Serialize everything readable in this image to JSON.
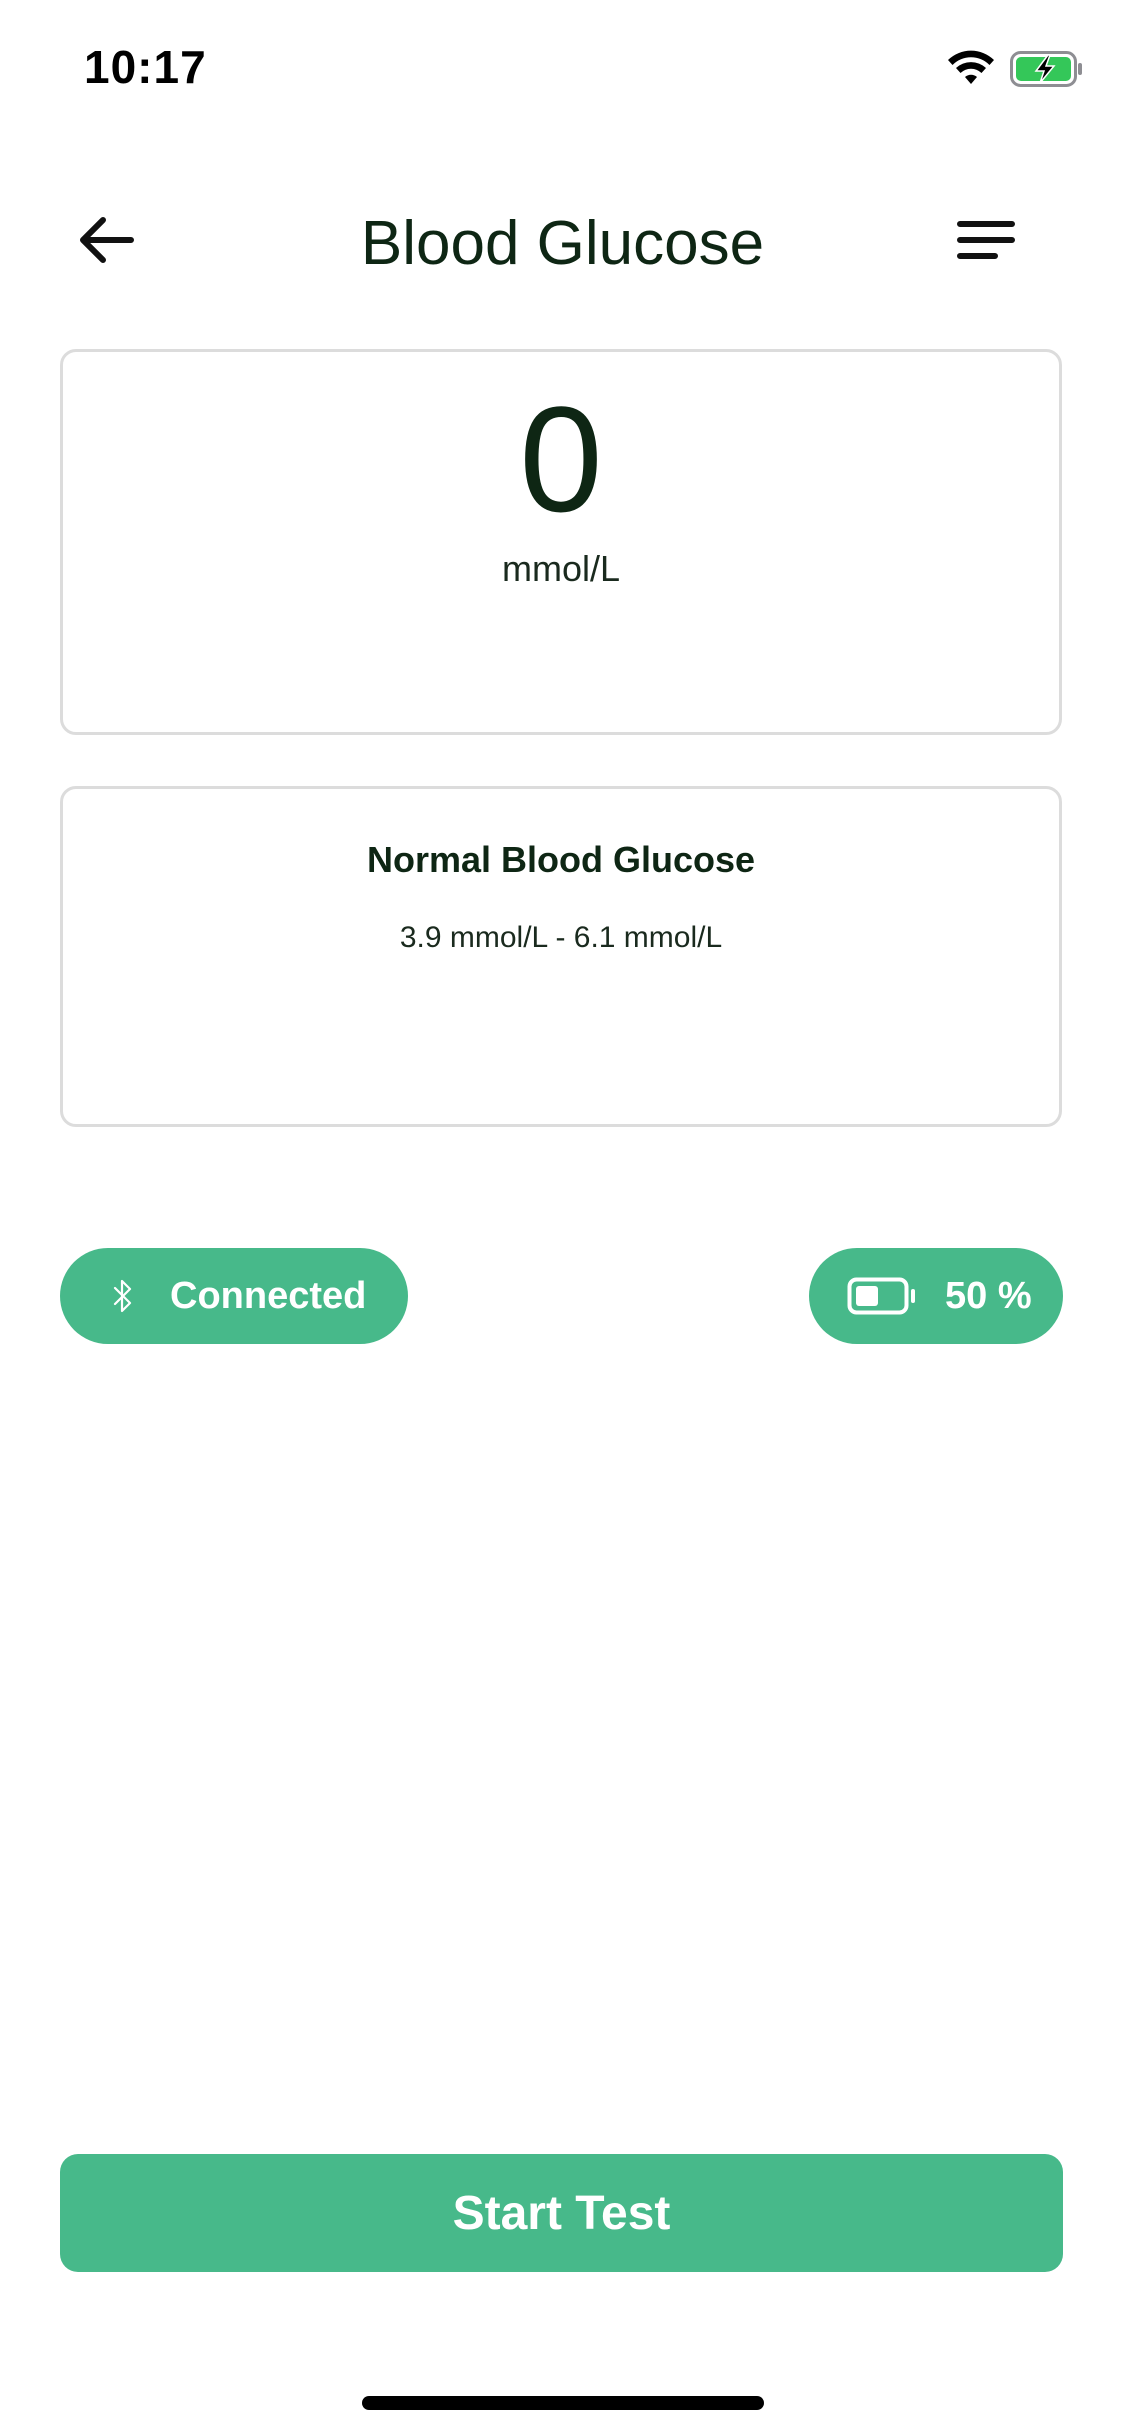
{
  "status_bar": {
    "time": "10:17",
    "wifi_icon": "wifi-icon",
    "battery_icon": "battery-charging-icon",
    "battery_color": "#34c759"
  },
  "header": {
    "title": "Blood Glucose",
    "back_icon": "arrow-left-icon",
    "menu_icon": "hamburger-menu-icon"
  },
  "reading": {
    "value": "0",
    "unit": "mmol/L"
  },
  "normal_range": {
    "title": "Normal Blood Glucose",
    "value": "3.9 mmol/L - 6.1 mmol/L"
  },
  "device": {
    "connection_label": "Connected",
    "connection_icon": "bluetooth-icon",
    "battery_label": "50 %",
    "battery_level": 0.5,
    "battery_icon": "battery-icon"
  },
  "actions": {
    "start_label": "Start Test"
  },
  "colors": {
    "accent": "#47b98a",
    "text": "#0e2614",
    "card_border": "#dcdcdc"
  }
}
